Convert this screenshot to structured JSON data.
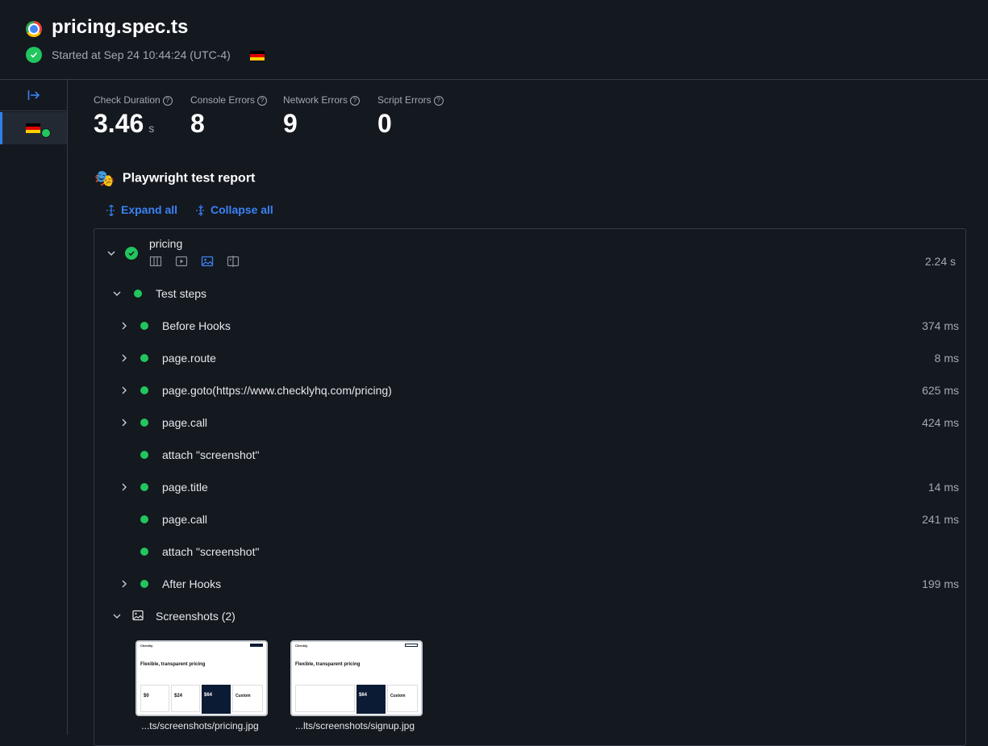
{
  "header": {
    "title": "pricing.spec.ts",
    "started": "Started at Sep 24 10:44:24 (UTC-4)"
  },
  "metrics": [
    {
      "label": "Check Duration",
      "value": "3.46",
      "unit": "s"
    },
    {
      "label": "Console Errors",
      "value": "8"
    },
    {
      "label": "Network Errors",
      "value": "9"
    },
    {
      "label": "Script Errors",
      "value": "0"
    }
  ],
  "report": {
    "title": "Playwright test report",
    "expand_all": "Expand all",
    "collapse_all": "Collapse all"
  },
  "test": {
    "name": "pricing",
    "duration": "2.24 s",
    "tab_icons": [
      "columns-icon",
      "video-icon",
      "image-icon",
      "compare-icon"
    ]
  },
  "test_steps": {
    "label": "Test steps",
    "steps": [
      {
        "label": "Before Hooks",
        "duration": "374 ms",
        "expandable": true
      },
      {
        "label": "page.route",
        "duration": "8 ms",
        "expandable": true
      },
      {
        "label": "page.goto(https://www.checklyhq.com/pricing)",
        "duration": "625 ms",
        "expandable": true
      },
      {
        "label": "page.call",
        "duration": "424 ms",
        "expandable": true
      },
      {
        "label": "attach \"screenshot\"",
        "duration": "",
        "expandable": false
      },
      {
        "label": "page.title",
        "duration": "14 ms",
        "expandable": true
      },
      {
        "label": "page.call",
        "duration": "241 ms",
        "expandable": false
      },
      {
        "label": "attach \"screenshot\"",
        "duration": "",
        "expandable": false
      },
      {
        "label": "After Hooks",
        "duration": "199 ms",
        "expandable": true
      }
    ]
  },
  "screenshots": {
    "label": "Screenshots (2)",
    "items": [
      {
        "caption": "...ts/screenshots/pricing.jpg",
        "heading": "Flexible, transparent pricing",
        "brand": "Checkly",
        "prices": [
          "$0",
          "$24",
          "$64",
          "Custom"
        ]
      },
      {
        "caption": "...lts/screenshots/signup.jpg",
        "heading": "Flexible, transparent pricing",
        "brand": "Checkly",
        "prices": [
          "",
          "",
          "$64",
          "Custom"
        ]
      }
    ]
  },
  "colors": {
    "success": "#22c55e",
    "accent": "#3b82f6",
    "background": "#14181f"
  }
}
